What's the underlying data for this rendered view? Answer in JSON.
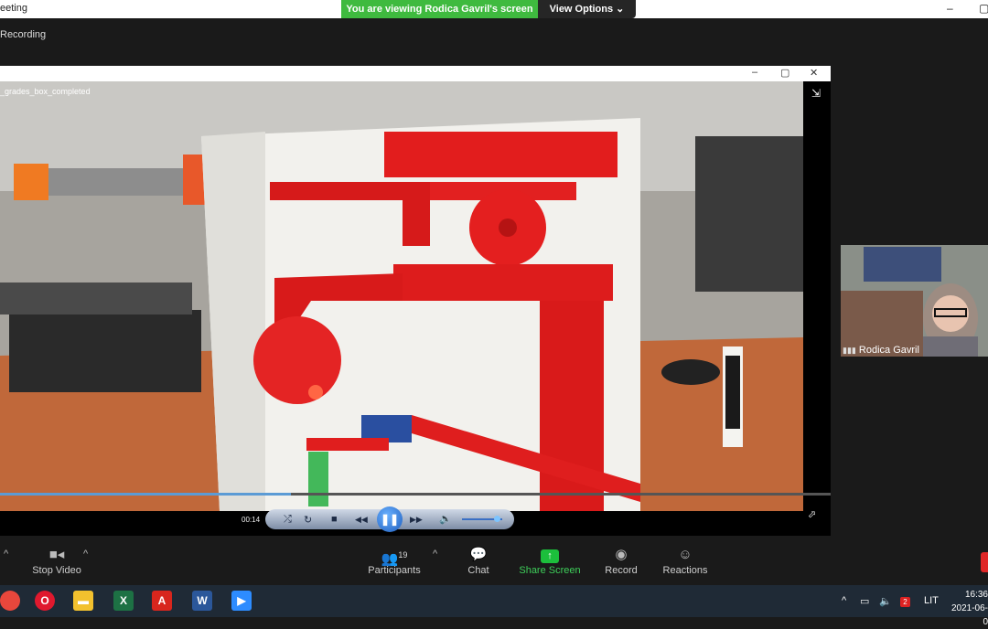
{
  "window": {
    "title": "eeting",
    "minimize": "–",
    "restore": "▢"
  },
  "banner": {
    "viewing": "You are viewing Rodica Gavril's screen",
    "view_options": "View Options ⌄"
  },
  "recording_label": "Recording",
  "player": {
    "controls_glyphs": {
      "min": "–",
      "max": "▢",
      "close": "✕",
      "fullscreen": "⇲",
      "corner": "⬀"
    },
    "filename": "_grades_box_completed",
    "time": "00:14",
    "progress": 0.35,
    "volume": 0.8,
    "buttons": {
      "shuffle": "⤮",
      "repeat": "↻",
      "stop": "■",
      "prev": "◀◀",
      "play": "❚❚",
      "next": "▶▶",
      "volume": "🔈"
    }
  },
  "participant": {
    "name": "Rodica Gavril"
  },
  "toolbar": {
    "stop_video": "Stop Video",
    "participants": "Participants",
    "participants_count": "19",
    "chat": "Chat",
    "share_screen": "Share Screen",
    "record": "Record",
    "reactions": "Reactions",
    "caret": "^"
  },
  "taskbar": {
    "apps": [
      {
        "name": "chrome",
        "glyph": "",
        "color": "#e8473c"
      },
      {
        "name": "opera",
        "glyph": "O",
        "color": "#e0192e"
      },
      {
        "name": "file-explorer",
        "glyph": "▬",
        "color": "#f2c12e"
      },
      {
        "name": "excel",
        "glyph": "X",
        "color": "#1d7144"
      },
      {
        "name": "acrobat",
        "glyph": "A",
        "color": "#d8261d"
      },
      {
        "name": "word",
        "glyph": "W",
        "color": "#2b579a"
      },
      {
        "name": "zoom",
        "glyph": "▶",
        "color": "#2d8cff"
      }
    ],
    "lang": "LIT",
    "time": "16:36",
    "date": "2021-06-0",
    "tray": {
      "caret": "^",
      "battery": "▭",
      "volume": "🔈",
      "notify_count": "2"
    }
  }
}
